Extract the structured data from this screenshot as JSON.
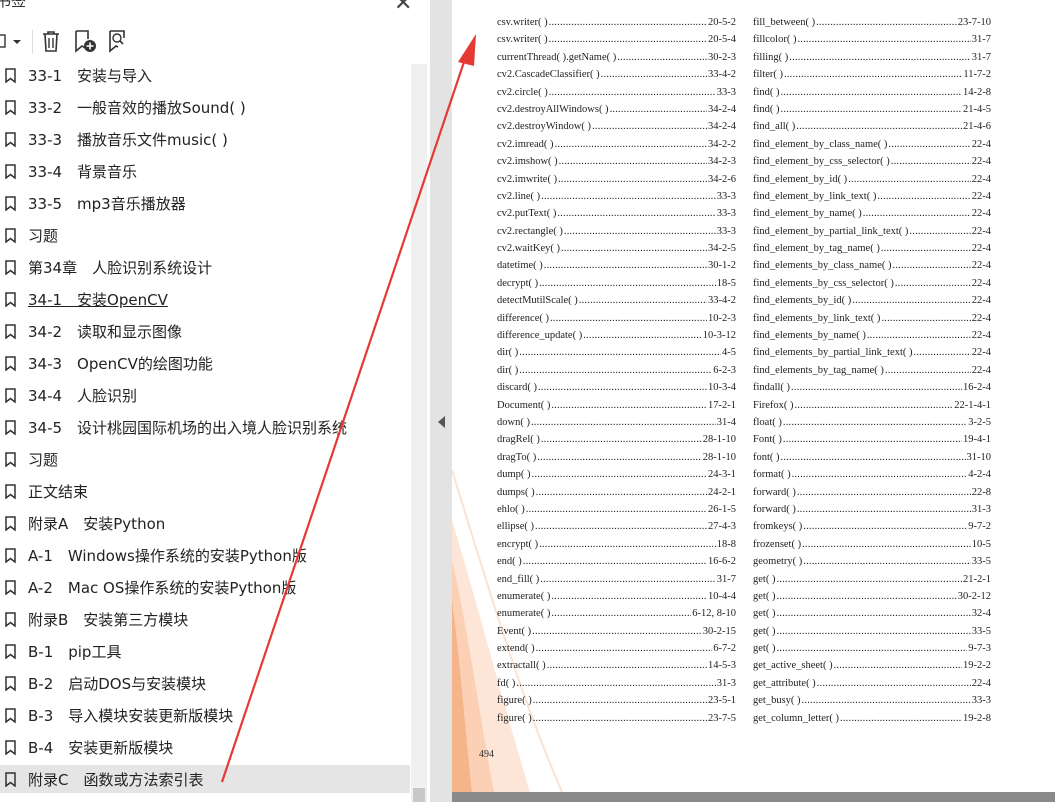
{
  "sidebar": {
    "title": "书签",
    "close_glyph": "✕",
    "toolbar": [
      {
        "icon": "expand-options-icon",
        "label": "Expand options"
      },
      {
        "icon": "trash-icon",
        "label": "Delete bookmark"
      },
      {
        "icon": "add-bookmark-icon",
        "label": "Add bookmark"
      },
      {
        "icon": "search-bookmark-icon",
        "label": "Find current bookmark"
      }
    ],
    "items": [
      {
        "label": "33-1　安装与导入"
      },
      {
        "label": "33-2　一般音效的播放Sound( )"
      },
      {
        "label": "33-3　播放音乐文件music( )"
      },
      {
        "label": "33-4　背景音乐"
      },
      {
        "label": "33-5　mp3音乐播放器"
      },
      {
        "label": "习题"
      },
      {
        "label": "第34章　人脸识别系统设计"
      },
      {
        "label": "34-1　安装OpenCV"
      },
      {
        "label": "34-2　读取和显示图像"
      },
      {
        "label": "34-3　OpenCV的绘图功能"
      },
      {
        "label": "34-4　人脸识别"
      },
      {
        "label": "34-5　设计桃园国际机场的出入境人脸识别系统"
      },
      {
        "label": "习题"
      },
      {
        "label": "正文结束"
      },
      {
        "label": "附录A　安装Python"
      },
      {
        "label": "A-1　Windows操作系统的安装Python版"
      },
      {
        "label": "A-2　Mac OS操作系统的安装Python版"
      },
      {
        "label": "附录B　安装第三方模块"
      },
      {
        "label": "B-1　pip工具"
      },
      {
        "label": "B-2　启动DOS与安装模块"
      },
      {
        "label": "B-3　导入模块安装更新版模块"
      },
      {
        "label": "B-4　安装更新版模块"
      },
      {
        "label": "附录C　函数或方法索引表"
      }
    ],
    "selected_index": 22,
    "underlined_index": 7
  },
  "page": {
    "page_number": "494",
    "left_column": [
      {
        "name": "csv.writer( )",
        "page": "20-5-2"
      },
      {
        "name": "csv.writer( )",
        "page": "20-5-4"
      },
      {
        "name": "currentThread( ).getName( )",
        "page": "30-2-3"
      },
      {
        "name": "cv2.CascadeClassifier( )",
        "page": "33-4-2"
      },
      {
        "name": "cv2.circle( )",
        "page": "33-3"
      },
      {
        "name": "cv2.destroyAllWindows( )",
        "page": "34-2-4"
      },
      {
        "name": "cv2.destroyWindow( )",
        "page": "34-2-4"
      },
      {
        "name": "cv2.imread( )",
        "page": "34-2-2"
      },
      {
        "name": "cv2.imshow( )",
        "page": "34-2-3"
      },
      {
        "name": "cv2.imwrite( )",
        "page": "34-2-6"
      },
      {
        "name": "cv2.line( )",
        "page": "33-3"
      },
      {
        "name": "cv2.putText( )",
        "page": "33-3"
      },
      {
        "name": "cv2.rectangle( )",
        "page": "33-3"
      },
      {
        "name": "cv2.waitKey( )",
        "page": "34-2-5"
      },
      {
        "name": "datetime( )",
        "page": "30-1-2"
      },
      {
        "name": "decrypt( )",
        "page": "18-5"
      },
      {
        "name": "detectMutilScale( )",
        "page": "33-4-2"
      },
      {
        "name": "difference( )",
        "page": "10-2-3"
      },
      {
        "name": "difference_update( )",
        "page": "10-3-12"
      },
      {
        "name": "dir( )",
        "page": "4-5"
      },
      {
        "name": "dir( )",
        "page": "6-2-3"
      },
      {
        "name": "discard( )",
        "page": "10-3-4"
      },
      {
        "name": "Document( )",
        "page": "17-2-1"
      },
      {
        "name": "down( )",
        "page": "31-4"
      },
      {
        "name": "dragRel( )",
        "page": "28-1-10"
      },
      {
        "name": "dragTo( )",
        "page": "28-1-10"
      },
      {
        "name": "dump( )",
        "page": "24-3-1"
      },
      {
        "name": "dumps( )",
        "page": "24-2-1"
      },
      {
        "name": "ehlo( )",
        "page": "26-1-5"
      },
      {
        "name": "ellipse( )",
        "page": "27-4-3"
      },
      {
        "name": "encrypt( )",
        "page": "18-8"
      },
      {
        "name": "end( )",
        "page": "16-6-2"
      },
      {
        "name": "end_fill( )",
        "page": "31-7"
      },
      {
        "name": "enumerate( )",
        "page": "10-4-4"
      },
      {
        "name": "enumerate( )",
        "page": "6-12, 8-10"
      },
      {
        "name": "Event( )",
        "page": "30-2-15"
      },
      {
        "name": "extend( )",
        "page": "6-7-2"
      },
      {
        "name": "extractall( )",
        "page": "14-5-3"
      },
      {
        "name": "fd( )",
        "page": "31-3"
      },
      {
        "name": "figure( )",
        "page": "23-5-1"
      },
      {
        "name": "figure( )",
        "page": "23-7-5"
      }
    ],
    "right_column": [
      {
        "name": "fill_between( )",
        "page": "23-7-10"
      },
      {
        "name": "fillcolor( )",
        "page": "31-7"
      },
      {
        "name": "filling( )",
        "page": "31-7"
      },
      {
        "name": "filter( )",
        "page": "11-7-2"
      },
      {
        "name": "find( )",
        "page": "14-2-8"
      },
      {
        "name": "find( )",
        "page": "21-4-5"
      },
      {
        "name": "find_all( )",
        "page": "21-4-6"
      },
      {
        "name": "find_element_by_class_name( )",
        "page": "22-4"
      },
      {
        "name": "find_element_by_css_selector( )",
        "page": "22-4"
      },
      {
        "name": "find_element_by_id( )",
        "page": "22-4"
      },
      {
        "name": "find_element_by_link_text( )",
        "page": "22-4"
      },
      {
        "name": "find_element_by_name( )",
        "page": "22-4"
      },
      {
        "name": "find_element_by_partial_link_text( )",
        "page": "22-4"
      },
      {
        "name": "find_element_by_tag_name( )",
        "page": "22-4"
      },
      {
        "name": "find_elements_by_class_name( )",
        "page": "22-4"
      },
      {
        "name": "find_elements_by_css_selector( )",
        "page": "22-4"
      },
      {
        "name": "find_elements_by_id( )",
        "page": "22-4"
      },
      {
        "name": "find_elements_by_link_text( )",
        "page": "22-4"
      },
      {
        "name": "find_elements_by_name( )",
        "page": "22-4"
      },
      {
        "name": "find_elements_by_partial_link_text( )",
        "page": "22-4"
      },
      {
        "name": "find_elements_by_tag_name( )",
        "page": "22-4"
      },
      {
        "name": "findall( )",
        "page": "16-2-4"
      },
      {
        "name": "Firefox( )",
        "page": "22-1-4-1"
      },
      {
        "name": "float( )",
        "page": "3-2-5"
      },
      {
        "name": "Font( )",
        "page": "19-4-1"
      },
      {
        "name": "font( )",
        "page": "31-10"
      },
      {
        "name": "format( )",
        "page": "4-2-4"
      },
      {
        "name": "forward( )",
        "page": "22-8"
      },
      {
        "name": "forward( )",
        "page": "31-3"
      },
      {
        "name": "fromkeys( )",
        "page": "9-7-2"
      },
      {
        "name": "frozenset( )",
        "page": "10-5"
      },
      {
        "name": "geometry( )",
        "page": "33-5"
      },
      {
        "name": "get( )",
        "page": "21-2-1"
      },
      {
        "name": "get( )",
        "page": "30-2-12"
      },
      {
        "name": "get( )",
        "page": "32-4"
      },
      {
        "name": "get( )",
        "page": "33-5"
      },
      {
        "name": "get( )",
        "page": "9-7-3"
      },
      {
        "name": "get_active_sheet( )",
        "page": "19-2-2"
      },
      {
        "name": "get_attribute( )",
        "page": "22-4"
      },
      {
        "name": "get_busy( )",
        "page": "33-3"
      },
      {
        "name": "get_column_letter( )",
        "page": "19-2-8"
      }
    ]
  },
  "colors": {
    "annotation_arrow": "#e53935",
    "page_decoration": "#f6b48a",
    "selected_row": "#e5e5e5"
  }
}
